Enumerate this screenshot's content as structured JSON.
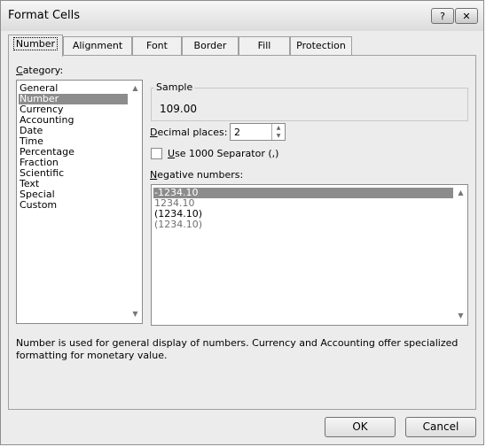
{
  "window": {
    "title": "Format Cells"
  },
  "titlebar": {
    "help_glyph": "?",
    "close_glyph": "✕"
  },
  "tabs": [
    {
      "label": "Number",
      "active": true
    },
    {
      "label": "Alignment"
    },
    {
      "label": "Font"
    },
    {
      "label": "Border"
    },
    {
      "label": "Fill"
    },
    {
      "label": "Protection"
    }
  ],
  "category": {
    "label": "Category:",
    "items": [
      "General",
      "Number",
      "Currency",
      "Accounting",
      "Date",
      "Time",
      "Percentage",
      "Fraction",
      "Scientific",
      "Text",
      "Special",
      "Custom"
    ],
    "selected": "Number"
  },
  "sample": {
    "label": "Sample",
    "value": "109.00"
  },
  "decimal_places": {
    "label": "Decimal places:",
    "value": "2"
  },
  "separator": {
    "label": "Use 1000 Separator (,)",
    "checked": false
  },
  "negative_numbers": {
    "label": "Negative numbers:",
    "items": [
      "-1234.10",
      "1234.10",
      "(1234.10)",
      "(1234.10)"
    ],
    "selected_index": 0,
    "item_colors": [
      "#ffffff",
      "#6f6f6f",
      "#000000",
      "#6f6f6f"
    ]
  },
  "description": "Number is used for general display of numbers.  Currency and Accounting offer specialized formatting for monetary value.",
  "buttons": {
    "ok": "OK",
    "cancel": "Cancel"
  }
}
